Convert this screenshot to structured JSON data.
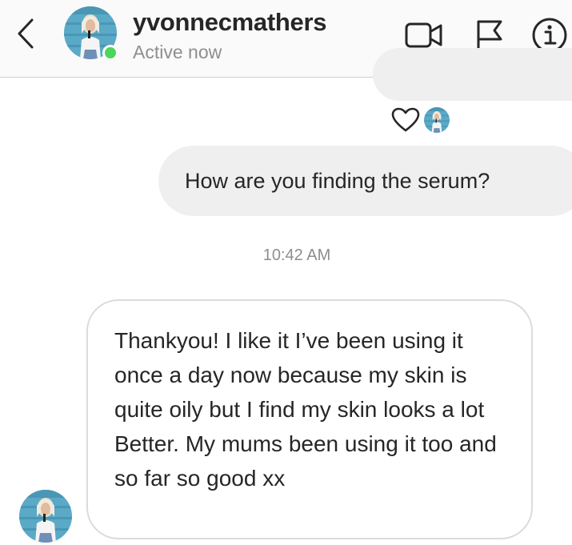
{
  "header": {
    "username": "yvonnecmathers",
    "status": "Active now",
    "icons": [
      "chevron-left-icon",
      "video-camera-icon",
      "flag-icon",
      "info-icon"
    ]
  },
  "messages": {
    "sent_text": "How are you finding the serum?",
    "timestamp": "10:42 AM",
    "received_text": "Thankyou! I like it I’ve been using it once a day now because my skin is quite oily but I find my skin looks a lot Better. My mums been using it too and so far so good xx"
  },
  "colors": {
    "active": "#4cd55b",
    "sent_bubble": "#efefef",
    "muted_text": "#8e8e8e"
  }
}
